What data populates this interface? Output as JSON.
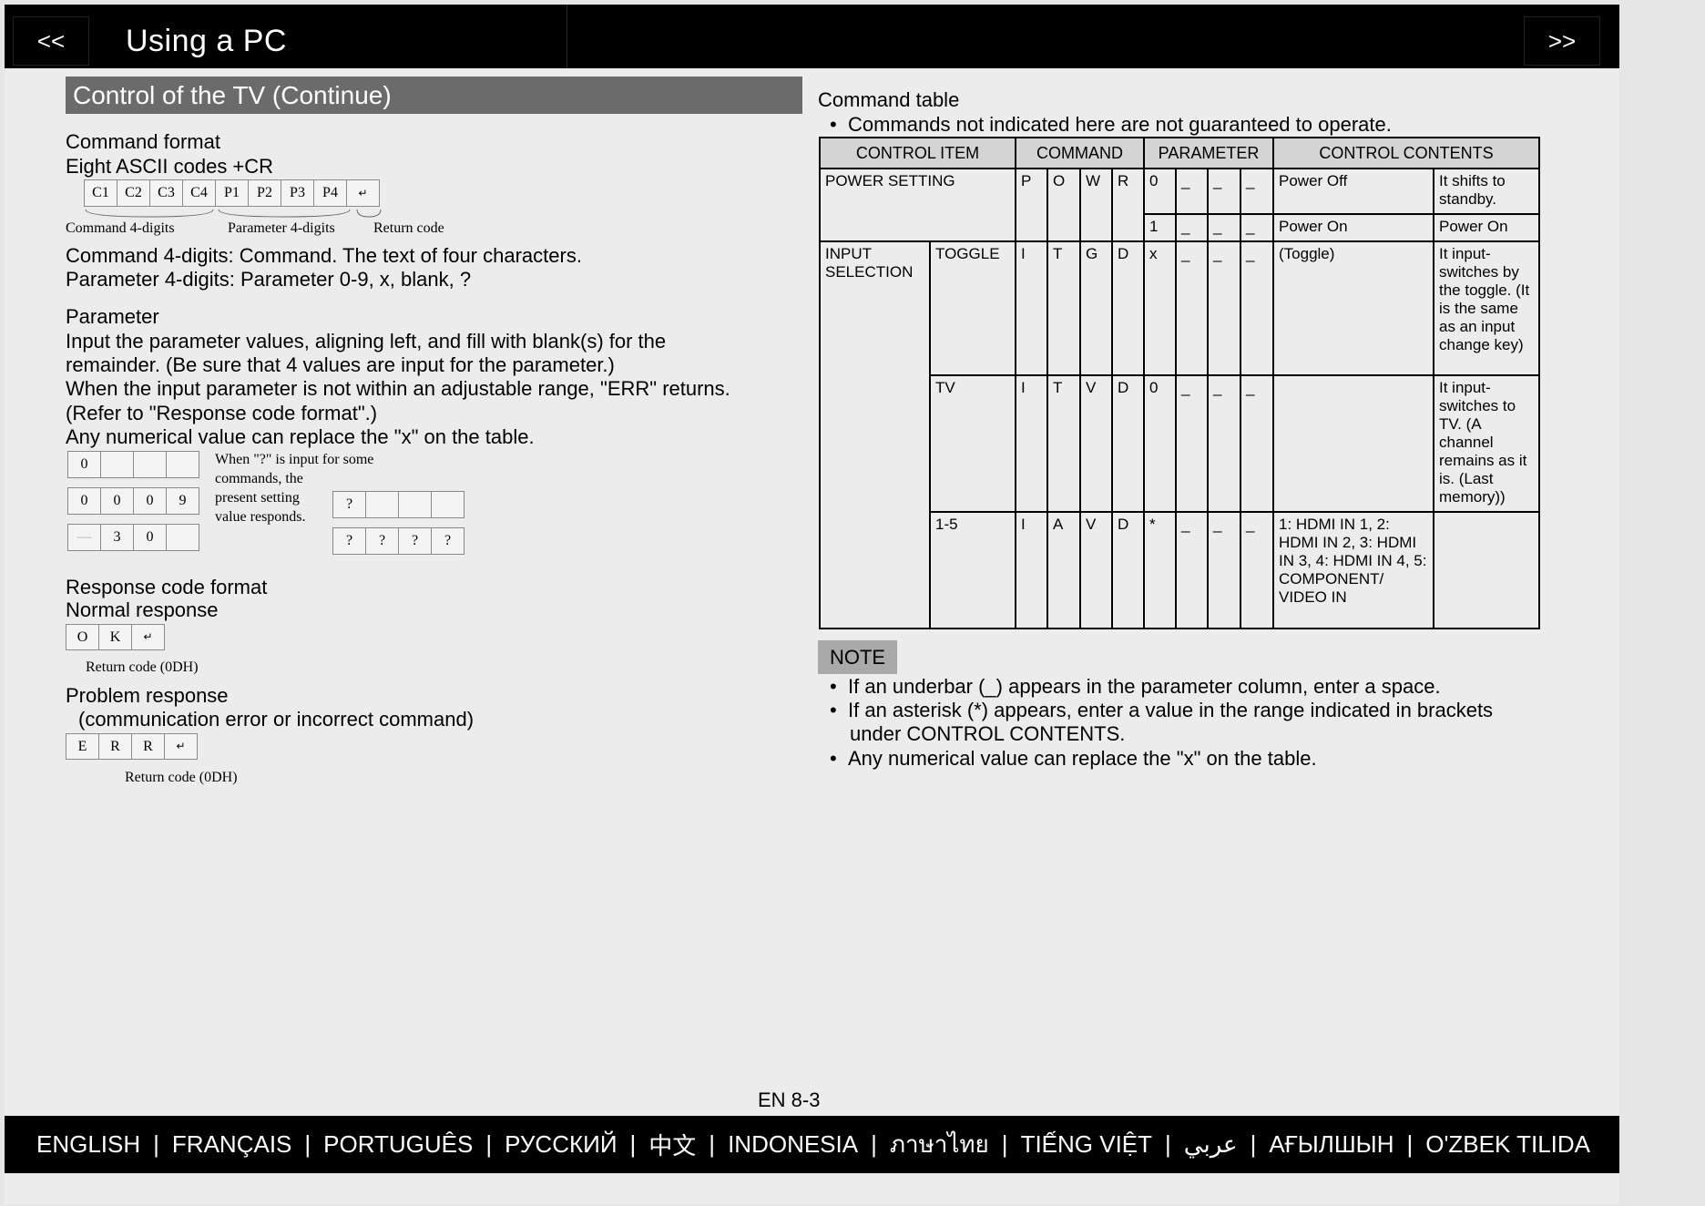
{
  "header": {
    "title": "Using a PC",
    "prev_label": "<<",
    "next_label": ">>"
  },
  "left": {
    "section_title": "Control of the TV (Continue)",
    "command_format_heading": "Command format",
    "eight_ascii": "Eight ASCII codes +CR",
    "code_boxes": [
      "C1",
      "C2",
      "C3",
      "C4",
      "P1",
      "P2",
      "P3",
      "P4",
      "↵"
    ],
    "label_cmd4": "Command 4-digits",
    "label_param4": "Parameter 4-digits",
    "label_return": "Return code",
    "cmd4_desc": "Command 4-digits: Command. The text of four characters.",
    "param4_desc": "Parameter 4-digits: Parameter 0-9, x, blank, ?",
    "parameter_heading": "Parameter",
    "param_line1": "Input the parameter values, aligning left, and fill with blank(s) for the",
    "param_line2": "remainder. (Be sure that 4 values are input for the parameter.)",
    "param_line3": "When the input parameter is not within an adjustable range, \"ERR\" returns.",
    "param_line4": "(Refer to \"Response code format\".)",
    "param_line5": "Any numerical value can replace the \"x\" on the table.",
    "example_row1": [
      "0",
      "",
      "",
      ""
    ],
    "example_row2": [
      "0",
      "0",
      "0",
      "9"
    ],
    "example_row3": [
      "—",
      "3",
      "0",
      ""
    ],
    "query_row1": [
      "?",
      "",
      "",
      ""
    ],
    "query_row2": [
      "?",
      "?",
      "?",
      "?"
    ],
    "query_note": [
      "When \"?\" is input for some",
      "commands, the",
      "present setting",
      "value responds."
    ],
    "response_heading": "Response code format",
    "normal_response": "Normal response",
    "ok_boxes": [
      "O",
      "K",
      "↵"
    ],
    "return_code_0dh_1": "Return code (0DH)",
    "problem_response": "Problem response",
    "problem_detail": "(communication error or incorrect command)",
    "err_boxes": [
      "E",
      "R",
      "R",
      "↵"
    ],
    "return_code_0dh_2": "Return code (0DH)"
  },
  "right": {
    "command_table_heading": "Command table",
    "not_guaranteed": "Commands not indicated here are not guaranteed to operate.",
    "headers": [
      "CONTROL ITEM",
      "COMMAND",
      "PARAMETER",
      "CONTROL CONTENTS"
    ],
    "power_setting": "POWER SETTING",
    "power_cmd": [
      "P",
      "O",
      "W",
      "R"
    ],
    "power_off_param": [
      "0",
      "_",
      "_",
      "_"
    ],
    "power_off": "Power Off",
    "power_off_desc": "It shifts to standby.",
    "power_on_param": [
      "1",
      "_",
      "_",
      "_"
    ],
    "power_on": "Power On",
    "power_on_desc": "Power On",
    "input_selection": "INPUT SELECTION",
    "toggle": "TOGGLE",
    "toggle_cmd": [
      "I",
      "T",
      "G",
      "D"
    ],
    "toggle_param": [
      "x",
      "_",
      "_",
      "_"
    ],
    "toggle_content": "(Toggle)",
    "toggle_desc": "It input-switches by the toggle. (It is the same as an input change key)",
    "tv": "TV",
    "tv_cmd": [
      "I",
      "T",
      "V",
      "D"
    ],
    "tv_param": [
      "0",
      "_",
      "_",
      "_"
    ],
    "tv_desc": "It input-switches to TV. (A channel remains as it is. (Last memory))",
    "range": "1-5",
    "range_cmd": [
      "I",
      "A",
      "V",
      "D"
    ],
    "range_param": [
      "*",
      "_",
      "_",
      "_"
    ],
    "range_content": "1: HDMI IN 1, 2: HDMI IN 2, 3: HDMI IN 3, 4: HDMI IN 4, 5: COMPONENT/ VIDEO IN",
    "note_label": "NOTE",
    "note1": "If an underbar (_) appears in the parameter column, enter a space.",
    "note2a": "If an asterisk (*) appears, enter a value in the range indicated in brackets",
    "note2b": "under CONTROL CONTENTS.",
    "note3": "Any numerical value can replace the \"x\" on the table."
  },
  "footer": {
    "page_number": "EN 8-3",
    "languages": [
      "ENGLISH",
      "FRANÇAIS",
      "PORTUGUÊS",
      "РУССКИЙ",
      "中文",
      "INDONESIA",
      "ภาษาไทย",
      "TIẾNG VIỆT",
      "عربي",
      "АҒЫЛШЫН",
      "O'ZBEK TILIDA"
    ]
  }
}
